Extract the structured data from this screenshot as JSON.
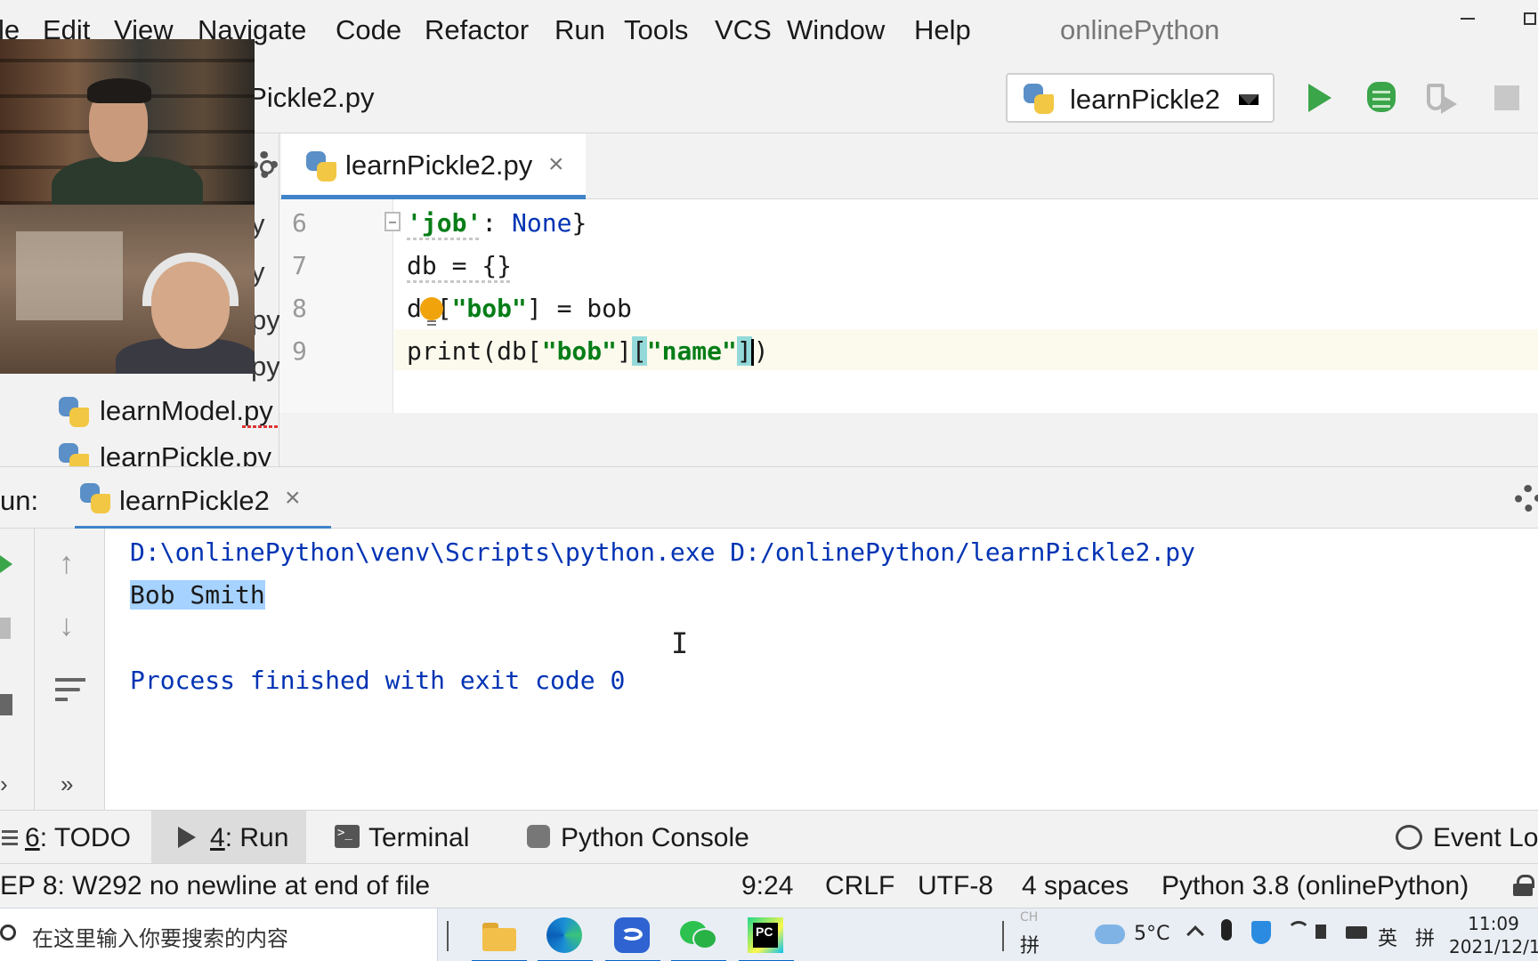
{
  "menu": {
    "items": [
      "le",
      "Edit",
      "View",
      "Navigate",
      "Code",
      "Refactor",
      "Run",
      "Tools",
      "VCS",
      "Window",
      "Help"
    ],
    "app_title": "onlinePython"
  },
  "toolbar": {
    "breadcrumb": "nPickle2.py",
    "run_config": "learnPickle2"
  },
  "project": {
    "fragments": [
      "y",
      "y",
      "py",
      "py"
    ],
    "files": [
      "learnModel.py",
      "learnPickle.py"
    ]
  },
  "editor": {
    "tab_label": "learnPickle2.py",
    "close_glyph": "×",
    "line_numbers": [
      "6",
      "7",
      "8",
      "9"
    ],
    "lines": {
      "l6_str": "'job'",
      "l6_rest": ": ",
      "l6_none": "None",
      "l6_end": "}",
      "l7": "db = {}",
      "l8_pre": "d",
      "l8_space": " ",
      "l8_open": "[",
      "l8_str": "\"bob\"",
      "l8_rest": "] = bob",
      "l9_pre": "print(db[",
      "l9_str1": "\"bob\"",
      "l9_mid": "]",
      "l9_open": "[",
      "l9_str2": "\"name\"",
      "l9_close": "]",
      "l9_end": ")"
    }
  },
  "run": {
    "label": "un:",
    "tab_label": "learnPickle2",
    "console": {
      "command": "D:\\onlinePython\\venv\\Scripts\\python.exe D:/onlinePython/learnPickle2.py",
      "output": "Bob Smith",
      "finish": "Process finished with exit code 0"
    },
    "side": {
      "arrow_up": "↑",
      "arrow_down": "↓",
      "more_left": "›",
      "more": "»"
    }
  },
  "tool_tabs": {
    "todo_num": "6",
    "todo_rest": ": TODO",
    "run_num": "4",
    "run_rest": ": Run",
    "terminal": "Terminal",
    "python_console": "Python Console",
    "event_log": "Event Log"
  },
  "status": {
    "message": "EP 8: W292 no newline at end of file",
    "position": "9:24",
    "line_sep": "CRLF",
    "encoding": "UTF-8",
    "indent": "4 spaces",
    "interpreter": "Python 3.8 (onlinePython)"
  },
  "taskbar": {
    "search_placeholder": "在这里输入你要搜索的内容",
    "ime_top": "CH",
    "ime_bottom": "拼",
    "temperature": "5°C",
    "lang": "英",
    "ime2": "拼",
    "time": "11:09",
    "date": "2021/12/1"
  },
  "colors": {
    "accent": "#4083c9",
    "run_green": "#3ba54a",
    "string_green": "#067d17",
    "keyword_blue": "#0033b3",
    "selection": "#a6d2ff"
  }
}
